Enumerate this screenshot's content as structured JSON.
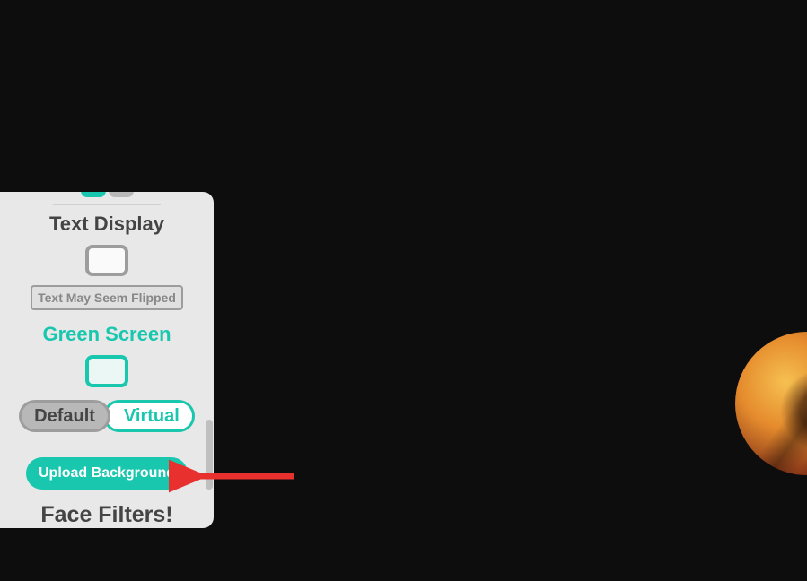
{
  "panel": {
    "textDisplay": {
      "heading": "Text Display",
      "note": "Text May Seem Flipped"
    },
    "greenScreen": {
      "heading": "Green Screen",
      "toggles": {
        "default": "Default",
        "virtual": "Virtual"
      },
      "uploadButton": "Upload Background"
    },
    "faceFilters": {
      "heading": "Face Filters!"
    }
  }
}
